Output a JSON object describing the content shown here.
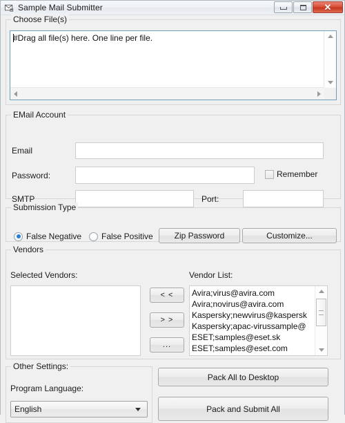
{
  "window": {
    "title": "Sample Mail Submitter",
    "icon": "mail-envelope-icon",
    "minimize_label": "",
    "maximize_label": "",
    "close_label": "✕"
  },
  "choose_files": {
    "legend": "Choose File(s)",
    "textarea_value": "#Drag all file(s) here. One line per file."
  },
  "email_account": {
    "legend": "EMail Account",
    "email_label": "Email",
    "email_value": "",
    "password_label": "Password:",
    "password_value": "",
    "remember_label": "Remember",
    "remember_checked": false,
    "smtp_label": "SMTP",
    "smtp_value": "",
    "port_label": "Port:",
    "port_value": ""
  },
  "submission_type": {
    "legend": "Submission Type",
    "false_negative_label": "False Negative",
    "false_positive_label": "False Positive",
    "selected": "False Negative",
    "zip_password_label": "Zip Password",
    "customize_label": "Customize..."
  },
  "vendors": {
    "legend": "Vendors",
    "selected_vendors_label": "Selected Vendors:",
    "vendor_list_label": "Vendor List:",
    "selected_vendors": [],
    "vendor_list": [
      "Avira;virus@avira.com",
      "Avira;novirus@avira.com",
      "Kaspersky;newvirus@kaspersk",
      "Kaspersky;apac-virussample@",
      "ESET;samples@eset.sk",
      "ESET;samples@eset.com"
    ],
    "move_left_label": "< <",
    "move_right_label": "> >",
    "more_label": "..."
  },
  "other_settings": {
    "legend": "Other Settings:",
    "program_language_label": "Program Language:",
    "language_value": "English"
  },
  "actions": {
    "pack_all_label": "Pack All to Desktop",
    "pack_submit_label": "Pack and Submit All"
  },
  "colors": {
    "accent": "#2a7fd4",
    "close_button": "#c53720",
    "focus_border": "#6f9dbd"
  }
}
